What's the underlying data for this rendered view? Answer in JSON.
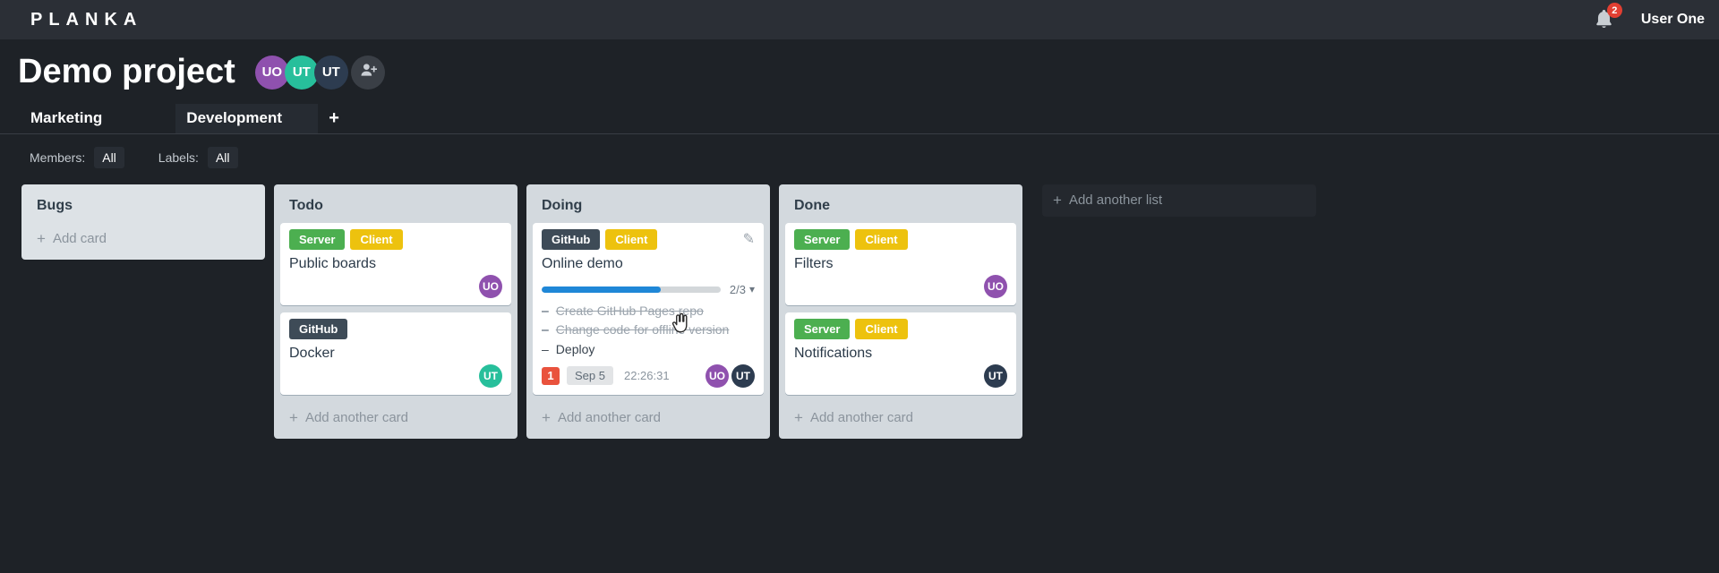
{
  "app": {
    "logo": "PLANKA",
    "notifications": {
      "count": "2"
    },
    "user": {
      "name": "User One"
    }
  },
  "project": {
    "title": "Demo project",
    "members": [
      {
        "initials": "UO"
      },
      {
        "initials": "UT"
      },
      {
        "initials": "UT"
      }
    ]
  },
  "tabs": {
    "items": [
      {
        "label": "Marketing",
        "active": false
      },
      {
        "label": "Development",
        "active": true
      }
    ],
    "add_button": "+"
  },
  "filters": {
    "members": {
      "label": "Members:",
      "value": "All"
    },
    "labels": {
      "label": "Labels:",
      "value": "All"
    }
  },
  "icons": {
    "edit": "✎",
    "caret_down": "▾"
  },
  "board": {
    "plus_icon": "+",
    "add_list": {
      "label": "Add another list"
    },
    "lists": [
      {
        "title": "Bugs",
        "add_card_label": "Add card",
        "cards": []
      },
      {
        "title": "Todo",
        "add_card_label": "Add another card",
        "cards": [
          {
            "title": "Public boards",
            "labels": [
              {
                "name": "Server"
              },
              {
                "name": "Client"
              }
            ],
            "members": [
              {
                "initials": "UO"
              }
            ]
          },
          {
            "title": "Docker",
            "labels": [
              {
                "name": "GitHub"
              }
            ],
            "members": [
              {
                "initials": "UT"
              }
            ]
          }
        ]
      },
      {
        "title": "Doing",
        "add_card_label": "Add another card",
        "cards": [
          {
            "title": "Online demo",
            "labels": [
              {
                "name": "GitHub"
              },
              {
                "name": "Client"
              }
            ],
            "tasks": {
              "progress_label": "2/3",
              "progress_percent": 66.7,
              "items": [
                {
                  "text": "Create GitHub Pages repo",
                  "completed": true
                },
                {
                  "text": "Change code for offline version",
                  "completed": true
                },
                {
                  "text": "Deploy",
                  "completed": false
                }
              ]
            },
            "badges": {
              "notification_count": "1",
              "due_date": "Sep 5",
              "timer": "22:26:31"
            },
            "members": [
              {
                "initials": "UO"
              },
              {
                "initials": "UT"
              }
            ]
          }
        ]
      },
      {
        "title": "Done",
        "add_card_label": "Add another card",
        "cards": [
          {
            "title": "Filters",
            "labels": [
              {
                "name": "Server"
              },
              {
                "name": "Client"
              }
            ],
            "members": [
              {
                "initials": "UO"
              }
            ]
          },
          {
            "title": "Notifications",
            "labels": [
              {
                "name": "Server"
              },
              {
                "name": "Client"
              }
            ],
            "members": [
              {
                "initials": "UT"
              }
            ]
          }
        ]
      }
    ]
  },
  "colors": {
    "topbar_bg": "#2b2f36",
    "page_bg": "#1e2227",
    "label_green": "#4caf50",
    "label_yellow": "#edc20e",
    "label_navy": "#3e4b57",
    "progress_blue": "#1f87d7",
    "notification_card_red": "#e9523d",
    "notification_badge_red": "#e23f32",
    "avatar_purple": "#8f51ae",
    "avatar_teal": "#27bf9b",
    "avatar_navy": "#2d3c50",
    "list_bg": "#d3d9de",
    "card_bg": "#ffffff"
  }
}
